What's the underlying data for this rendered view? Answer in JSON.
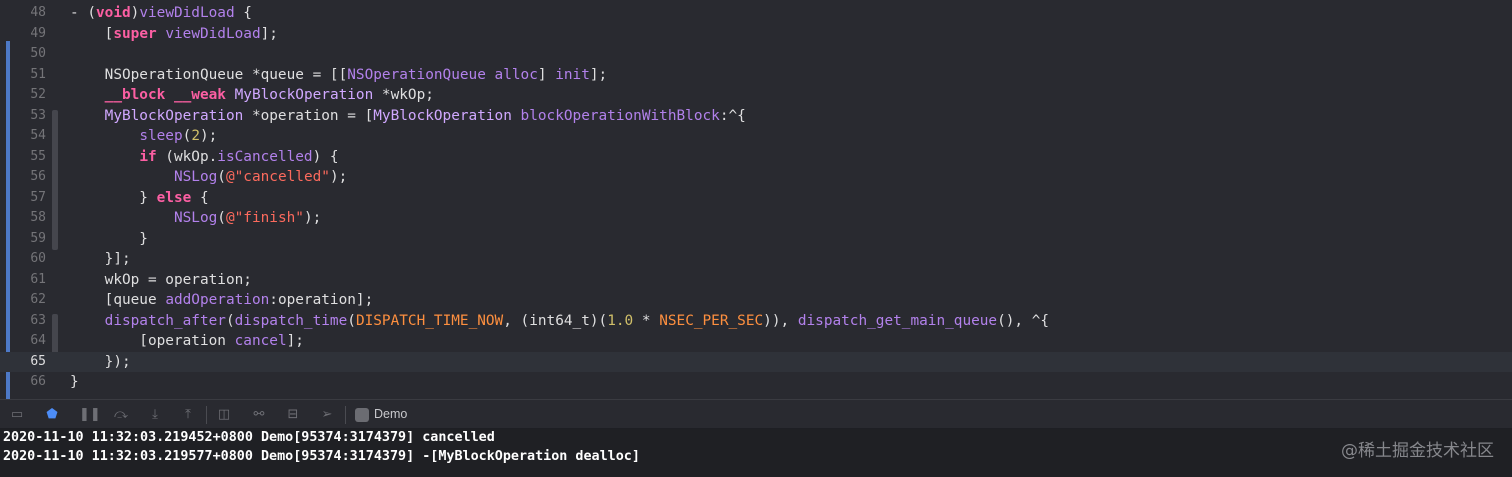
{
  "editor": {
    "lines": [
      {
        "num": "48",
        "current": false,
        "tokens": [
          {
            "c": "plain",
            "t": "- ("
          },
          {
            "c": "kw",
            "t": "void"
          },
          {
            "c": "plain",
            "t": ")"
          },
          {
            "c": "method",
            "t": "viewDidLoad"
          },
          {
            "c": "plain",
            "t": " {"
          }
        ]
      },
      {
        "num": "49",
        "current": false,
        "tokens": [
          {
            "c": "plain",
            "t": "    ["
          },
          {
            "c": "kw",
            "t": "super"
          },
          {
            "c": "plain",
            "t": " "
          },
          {
            "c": "method",
            "t": "viewDidLoad"
          },
          {
            "c": "plain",
            "t": "];"
          }
        ]
      },
      {
        "num": "50",
        "current": false,
        "tokens": []
      },
      {
        "num": "51",
        "current": false,
        "tokens": [
          {
            "c": "plain",
            "t": "    NSOperationQueue *queue = [["
          },
          {
            "c": "method",
            "t": "NSOperationQueue"
          },
          {
            "c": "plain",
            "t": " "
          },
          {
            "c": "method",
            "t": "alloc"
          },
          {
            "c": "plain",
            "t": "] "
          },
          {
            "c": "method",
            "t": "init"
          },
          {
            "c": "plain",
            "t": "];"
          }
        ]
      },
      {
        "num": "52",
        "current": false,
        "tokens": [
          {
            "c": "plain",
            "t": "    "
          },
          {
            "c": "kw",
            "t": "__block"
          },
          {
            "c": "plain",
            "t": " "
          },
          {
            "c": "kw",
            "t": "__weak"
          },
          {
            "c": "plain",
            "t": " "
          },
          {
            "c": "cls",
            "t": "MyBlockOperation"
          },
          {
            "c": "plain",
            "t": " *wkOp;"
          }
        ]
      },
      {
        "num": "53",
        "current": false,
        "tokens": [
          {
            "c": "plain",
            "t": "    "
          },
          {
            "c": "cls",
            "t": "MyBlockOperation"
          },
          {
            "c": "plain",
            "t": " *operation = ["
          },
          {
            "c": "cls",
            "t": "MyBlockOperation"
          },
          {
            "c": "plain",
            "t": " "
          },
          {
            "c": "method",
            "t": "blockOperationWithBlock"
          },
          {
            "c": "plain",
            "t": ":^{"
          }
        ]
      },
      {
        "num": "54",
        "current": false,
        "tokens": [
          {
            "c": "plain",
            "t": "        "
          },
          {
            "c": "method",
            "t": "sleep"
          },
          {
            "c": "plain",
            "t": "("
          },
          {
            "c": "num",
            "t": "2"
          },
          {
            "c": "plain",
            "t": ");"
          }
        ]
      },
      {
        "num": "55",
        "current": false,
        "tokens": [
          {
            "c": "plain",
            "t": "        "
          },
          {
            "c": "kw",
            "t": "if"
          },
          {
            "c": "plain",
            "t": " (wkOp."
          },
          {
            "c": "method",
            "t": "isCancelled"
          },
          {
            "c": "plain",
            "t": ") {"
          }
        ]
      },
      {
        "num": "56",
        "current": false,
        "tokens": [
          {
            "c": "plain",
            "t": "            "
          },
          {
            "c": "method",
            "t": "NSLog"
          },
          {
            "c": "plain",
            "t": "("
          },
          {
            "c": "str",
            "t": "@\"cancelled\""
          },
          {
            "c": "plain",
            "t": ");"
          }
        ]
      },
      {
        "num": "57",
        "current": false,
        "tokens": [
          {
            "c": "plain",
            "t": "        } "
          },
          {
            "c": "kw",
            "t": "else"
          },
          {
            "c": "plain",
            "t": " {"
          }
        ]
      },
      {
        "num": "58",
        "current": false,
        "tokens": [
          {
            "c": "plain",
            "t": "            "
          },
          {
            "c": "method",
            "t": "NSLog"
          },
          {
            "c": "plain",
            "t": "("
          },
          {
            "c": "str",
            "t": "@\"finish\""
          },
          {
            "c": "plain",
            "t": ");"
          }
        ]
      },
      {
        "num": "59",
        "current": false,
        "tokens": [
          {
            "c": "plain",
            "t": "        }"
          }
        ]
      },
      {
        "num": "60",
        "current": false,
        "tokens": [
          {
            "c": "plain",
            "t": "    }];"
          }
        ]
      },
      {
        "num": "61",
        "current": false,
        "tokens": [
          {
            "c": "plain",
            "t": "    wkOp = operation;"
          }
        ]
      },
      {
        "num": "62",
        "current": false,
        "tokens": [
          {
            "c": "plain",
            "t": "    [queue "
          },
          {
            "c": "method",
            "t": "addOperation"
          },
          {
            "c": "plain",
            "t": ":operation];"
          }
        ]
      },
      {
        "num": "63",
        "current": false,
        "tokens": [
          {
            "c": "plain",
            "t": "    "
          },
          {
            "c": "method",
            "t": "dispatch_after"
          },
          {
            "c": "plain",
            "t": "("
          },
          {
            "c": "method",
            "t": "dispatch_time"
          },
          {
            "c": "plain",
            "t": "("
          },
          {
            "c": "macro",
            "t": "DISPATCH_TIME_NOW"
          },
          {
            "c": "plain",
            "t": ", (int64_t)("
          },
          {
            "c": "num",
            "t": "1.0"
          },
          {
            "c": "plain",
            "t": " * "
          },
          {
            "c": "macro",
            "t": "NSEC_PER_SEC"
          },
          {
            "c": "plain",
            "t": ")), "
          },
          {
            "c": "method",
            "t": "dispatch_get_main_queue"
          },
          {
            "c": "plain",
            "t": "(), ^{"
          }
        ]
      },
      {
        "num": "64",
        "current": false,
        "tokens": [
          {
            "c": "plain",
            "t": "        [operation "
          },
          {
            "c": "method",
            "t": "cancel"
          },
          {
            "c": "plain",
            "t": "];"
          }
        ]
      },
      {
        "num": "65",
        "current": true,
        "tokens": [
          {
            "c": "plain",
            "t": "    });"
          }
        ]
      },
      {
        "num": "66",
        "current": false,
        "tokens": [
          {
            "c": "plain",
            "t": "}"
          }
        ]
      }
    ]
  },
  "debug_bar": {
    "target_label": "Demo",
    "icons": [
      "hide-debug-area-icon",
      "breakpoints-toggle-icon",
      "pause-icon",
      "step-over-icon",
      "step-into-icon",
      "step-out-icon",
      "view-hierarchy-icon",
      "memory-graph-icon",
      "environment-overrides-icon",
      "simulate-location-icon",
      "app-target-icon"
    ]
  },
  "console": {
    "lines": [
      "2020-11-10 11:32:03.219452+0800 Demo[95374:3174379] cancelled",
      "2020-11-10 11:32:03.219577+0800 Demo[95374:3174379] -[MyBlockOperation dealloc]"
    ]
  },
  "watermark": "@稀土掘金技术社区",
  "colors": {
    "background": "#292a30",
    "keyword": "#fc5fa3",
    "method": "#b281eb",
    "class": "#d0a8ff",
    "string": "#fc6a5d",
    "number": "#d0bf69",
    "macro": "#fd8f3f",
    "change_bar": "#4d79c7"
  }
}
